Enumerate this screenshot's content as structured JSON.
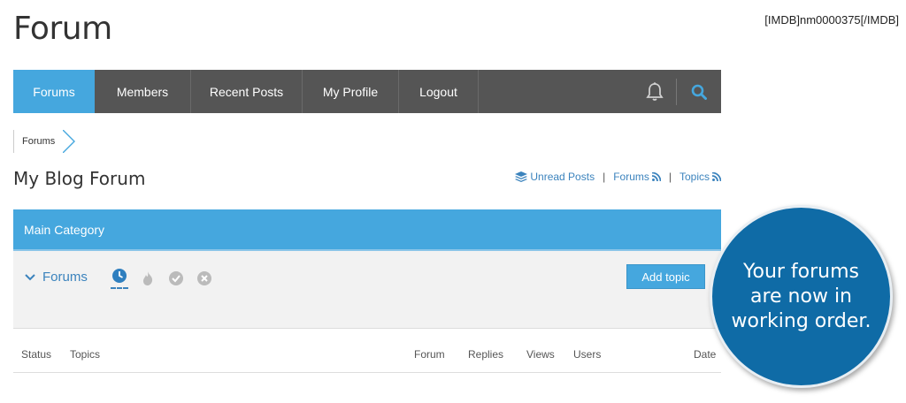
{
  "page": {
    "title": "Forum",
    "tag": "[IMDB]nm0000375[/IMDB]"
  },
  "nav": {
    "items": [
      "Forums",
      "Members",
      "Recent Posts",
      "My Profile",
      "Logout"
    ],
    "active_color": "#45a7de",
    "bg_color": "#555555"
  },
  "breadcrumb": {
    "items": [
      "Forums"
    ]
  },
  "forum": {
    "heading": "My Blog Forum",
    "links": {
      "unread": "Unread Posts",
      "forums": "Forums",
      "topics": "Topics"
    }
  },
  "category": {
    "name": "Main Category"
  },
  "panel": {
    "toggle_label": "Forums",
    "add_topic": "Add topic"
  },
  "table": {
    "columns": [
      "Status",
      "Topics",
      "Forum",
      "Replies",
      "Views",
      "Users",
      "Date"
    ]
  },
  "callout": {
    "text": "Your forums are now in working order."
  }
}
